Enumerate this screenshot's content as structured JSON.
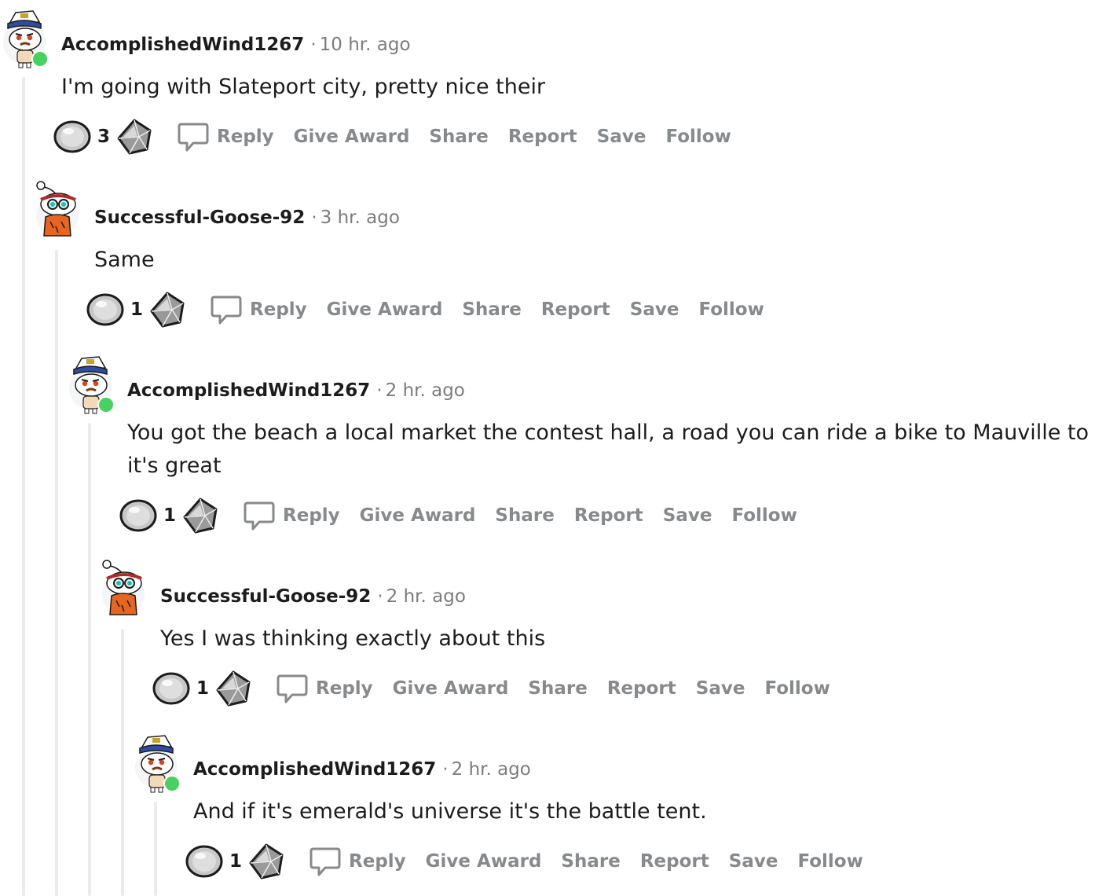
{
  "comments": [
    {
      "author": "AccomplishedWind1267",
      "separator": "·",
      "time": "10 hr. ago",
      "body": "I'm going with Slateport city, pretty nice their",
      "score": "3",
      "avatar": "captain-snoo-avatar",
      "online": true,
      "actions": {
        "reply": "Reply",
        "give_award": "Give Award",
        "share": "Share",
        "report": "Report",
        "save": "Save",
        "follow": "Follow"
      }
    },
    {
      "author": "Successful-Goose-92",
      "separator": "·",
      "time": "3 hr. ago",
      "body": "Same",
      "score": "1",
      "avatar": "goggles-snoo-avatar",
      "online": false,
      "actions": {
        "reply": "Reply",
        "give_award": "Give Award",
        "share": "Share",
        "report": "Report",
        "save": "Save",
        "follow": "Follow"
      }
    },
    {
      "author": "AccomplishedWind1267",
      "separator": "·",
      "time": "2 hr. ago",
      "body": "You got the beach a local market the contest hall, a road you can ride a bike to Mauville to it's great",
      "score": "1",
      "avatar": "captain-snoo-avatar",
      "online": true,
      "actions": {
        "reply": "Reply",
        "give_award": "Give Award",
        "share": "Share",
        "report": "Report",
        "save": "Save",
        "follow": "Follow"
      }
    },
    {
      "author": "Successful-Goose-92",
      "separator": "·",
      "time": "2 hr. ago",
      "body": "Yes I was thinking exactly about this",
      "score": "1",
      "avatar": "goggles-snoo-avatar",
      "online": false,
      "actions": {
        "reply": "Reply",
        "give_award": "Give Award",
        "share": "Share",
        "report": "Report",
        "save": "Save",
        "follow": "Follow"
      }
    },
    {
      "author": "AccomplishedWind1267",
      "separator": "·",
      "time": "2 hr. ago",
      "body": "And if it's emerald's universe it's the battle tent.",
      "score": "1",
      "avatar": "captain-snoo-avatar",
      "online": true,
      "actions": {
        "reply": "Reply",
        "give_award": "Give Award",
        "share": "Share",
        "report": "Report",
        "save": "Save",
        "follow": "Follow"
      }
    }
  ],
  "colors": {
    "online": "#46d160",
    "thread_line": "#e9ebed",
    "meta_gray": "#7c7c7c",
    "action_gray": "#878a8c"
  }
}
